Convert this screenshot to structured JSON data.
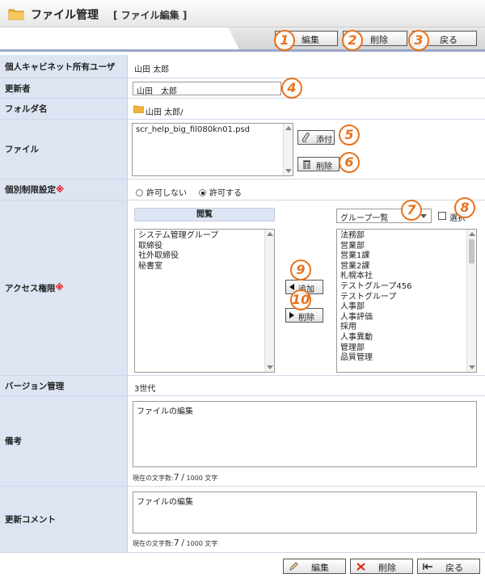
{
  "header": {
    "title": "ファイル管理",
    "subtitle": "[ ファイル編集 ]"
  },
  "toolbar": {
    "edit": "編集",
    "delete": "削除",
    "back": "戻る"
  },
  "callouts": [
    "1",
    "2",
    "3",
    "4",
    "5",
    "6",
    "7",
    "8",
    "9",
    "10"
  ],
  "rows": {
    "owner": {
      "label": "個人キャビネット所有ユーザ",
      "value": "山田 太郎"
    },
    "updater": {
      "label": "更新者",
      "value": "山田　太郎"
    },
    "folder": {
      "label": "フォルダ名",
      "value": "山田 太郎/"
    },
    "file": {
      "label": "ファイル",
      "filename": "scr_help_big_fil080kn01.psd",
      "attach": "添付",
      "remove": "削除"
    },
    "restriction": {
      "label": "個別制限設定",
      "mark": "※",
      "opt_no": "許可しない",
      "opt_yes": "許可する"
    },
    "access": {
      "label": "アクセス権限",
      "mark": "※",
      "view_header": "閲覧",
      "view_items": [
        "システム管理グループ",
        "取締役",
        "社外取締役",
        "秘書室"
      ],
      "group_select": "グループ一覧",
      "select_label": "選択",
      "add": "追加",
      "remove": "削除",
      "group_items": [
        "法務部",
        "営業部",
        "営業1課",
        "営業2課",
        "札幌本社",
        "テストグループ456",
        "テストグループ",
        "人事部",
        "人事評価",
        "採用",
        "人事異動",
        "管理部",
        "品質管理"
      ]
    },
    "version": {
      "label": "バージョン管理",
      "value": "3世代"
    },
    "note": {
      "label": "備考",
      "value": "ファイルの編集",
      "counter_label": "現在の文字数:",
      "count": "7",
      "sep": "/",
      "max": "1000 文字"
    },
    "comment": {
      "label": "更新コメント",
      "value": "ファイルの編集",
      "counter_label": "現在の文字数:",
      "count": "7",
      "sep": "/",
      "max": "1000 文字"
    }
  },
  "footer": {
    "edit": "編集",
    "delete": "削除",
    "back": "戻る"
  },
  "colors": {
    "label_bg": "#dde5f3",
    "callout": "#e8721c",
    "required": "#ee0000"
  }
}
